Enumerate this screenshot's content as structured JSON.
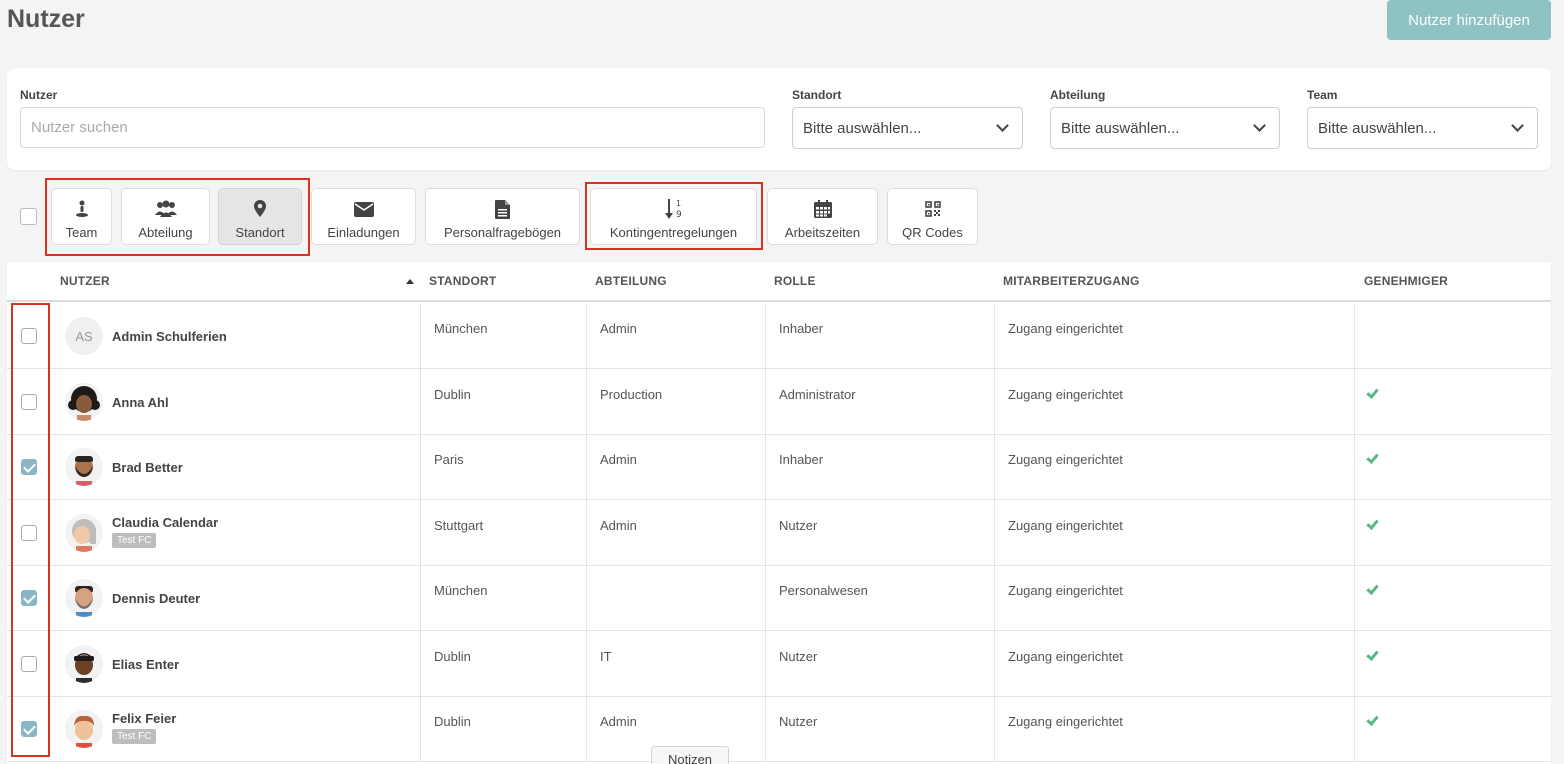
{
  "page": {
    "title": "Nutzer",
    "add_button": "Nutzer hinzufügen"
  },
  "filters": {
    "user_label": "Nutzer",
    "user_placeholder": "Nutzer suchen",
    "location_label": "Standort",
    "location_value": "Bitte auswählen...",
    "department_label": "Abteilung",
    "department_value": "Bitte auswählen...",
    "team_label": "Team",
    "team_value": "Bitte auswählen..."
  },
  "toolbar": {
    "team": "Team",
    "department": "Abteilung",
    "location": "Standort",
    "invitations": "Einladungen",
    "questionnaires": "Personalfragebögen",
    "quota_rules": "Kontingentregelungen",
    "work_hours": "Arbeitszeiten",
    "qr_codes": "QR Codes",
    "active": "location"
  },
  "table": {
    "headers": {
      "user": "NUTZER",
      "location": "STANDORT",
      "department": "ABTEILUNG",
      "role": "ROLLE",
      "access": "MITARBEITERZUGANG",
      "approver": "GENEHMIGER"
    },
    "rows": [
      {
        "name": "Admin Schulferien",
        "initials": "AS",
        "badge": "",
        "location": "München",
        "department": "Admin",
        "role": "Inhaber",
        "access": "Zugang eingerichtet",
        "approver": false,
        "checked": false,
        "avatar": "initials"
      },
      {
        "name": "Anna Ahl",
        "initials": "",
        "badge": "",
        "location": "Dublin",
        "department": "Production",
        "role": "Administrator",
        "access": "Zugang eingerichtet",
        "approver": true,
        "checked": false,
        "avatar": "curly-hair-woman"
      },
      {
        "name": "Brad Better",
        "initials": "",
        "badge": "",
        "location": "Paris",
        "department": "Admin",
        "role": "Inhaber",
        "access": "Zugang eingerichtet",
        "approver": true,
        "checked": true,
        "avatar": "man-beard"
      },
      {
        "name": "Claudia Calendar",
        "initials": "",
        "badge": "Test FC",
        "location": "Stuttgart",
        "department": "Admin",
        "role": "Nutzer",
        "access": "Zugang eingerichtet",
        "approver": true,
        "checked": false,
        "avatar": "gray-hair-woman"
      },
      {
        "name": "Dennis Deuter",
        "initials": "",
        "badge": "",
        "location": "München",
        "department": "",
        "role": "Personalwesen",
        "access": "Zugang eingerichtet",
        "approver": true,
        "checked": true,
        "avatar": "man-gray-beard"
      },
      {
        "name": "Elias Enter",
        "initials": "",
        "badge": "",
        "location": "Dublin",
        "department": "IT",
        "role": "Nutzer",
        "access": "Zugang eingerichtet",
        "approver": true,
        "checked": false,
        "avatar": "man-dark"
      },
      {
        "name": "Felix Feier",
        "initials": "",
        "badge": "Test FC",
        "location": "Dublin",
        "department": "Admin",
        "role": "Nutzer",
        "access": "Zugang eingerichtet",
        "approver": true,
        "checked": true,
        "avatar": "boy-brown-hair"
      }
    ]
  },
  "notes_tab": "Notizen",
  "colors": {
    "accent": "#8ab6c4",
    "button": "#8fc2c2",
    "highlight": "#d9321f",
    "check": "#5cb88a"
  }
}
